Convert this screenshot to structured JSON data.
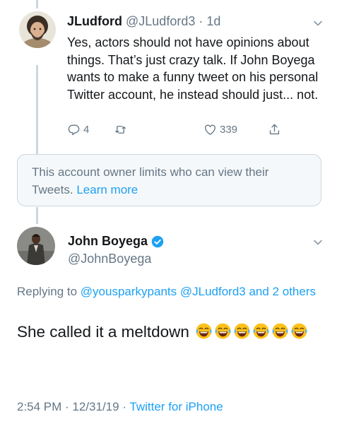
{
  "reply_tweet": {
    "display_name": "JLudford",
    "handle": "@JLudford3",
    "separator": " · ",
    "time": "1d",
    "text": "Yes, actors should not have opinions about things. That’s just crazy talk. If John Boyega wants to make a funny tweet on his personal Twitter account, he instead should just... not.",
    "actions": {
      "reply_count": "4",
      "retweet_count": "",
      "like_count": "339"
    },
    "avatar_icon": "user-avatar-bearded-man"
  },
  "restricted_notice": {
    "text": "This account owner limits who can view their Tweets.",
    "link": "Learn more"
  },
  "main_tweet": {
    "display_name": "John Boyega",
    "verified": true,
    "handle": "@JohnBoyega",
    "replying_prefix": "Replying to",
    "mention_1": "@yousparkypants",
    "mention_2": "@JLudford3",
    "mention_conjunction": "and",
    "mention_others": "2 others",
    "text": "She called it a meltdown",
    "emoji": "😂",
    "emoji_count": 6,
    "timestamp": "2:54 PM · 12/31/19 ·",
    "source": "Twitter for iPhone",
    "avatar_icon": "user-avatar-man-in-suit"
  },
  "colors": {
    "text": "#14171a",
    "secondary": "#657786",
    "link": "#1da1f2",
    "border": "#ccd6dd",
    "notice_bg": "#f5f8fa"
  }
}
